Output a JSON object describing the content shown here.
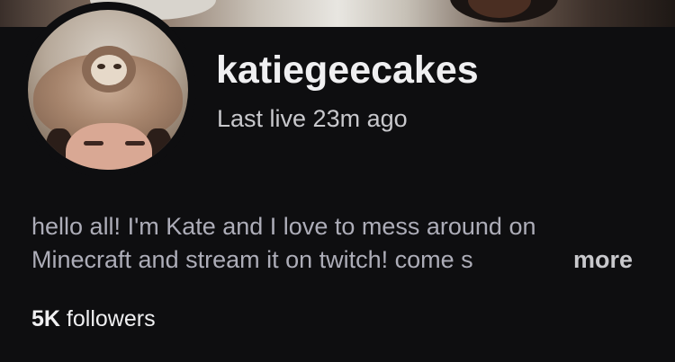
{
  "profile": {
    "username": "katiegeecakes",
    "last_live": "Last live 23m ago",
    "bio_line_1": "hello all! I'm Kate and I love to mess around on",
    "bio_line_2": "Minecraft and stream it on twitch! come s",
    "more_label": "more",
    "followers_count": "5K",
    "followers_label": "followers"
  },
  "colors": {
    "background": "#0e0e10",
    "primary_text": "#efeff1",
    "secondary_text": "#adadb8"
  }
}
